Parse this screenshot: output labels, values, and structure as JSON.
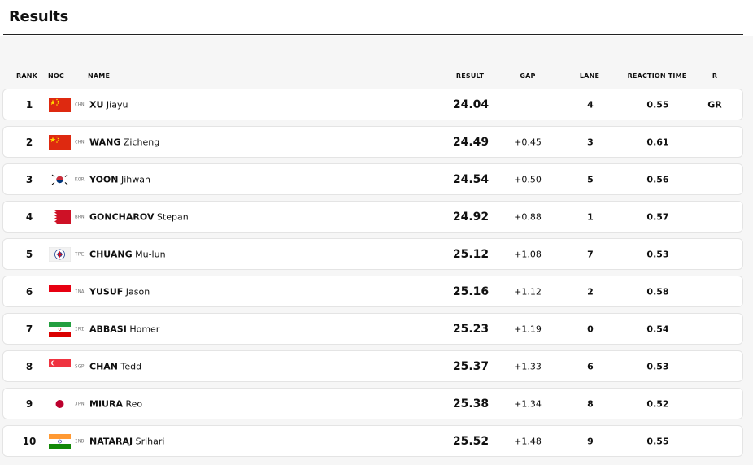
{
  "title": "Results",
  "columns": {
    "rank": "RANK",
    "noc": "NOC",
    "name": "NAME",
    "result": "RESULT",
    "gap": "GAP",
    "lane": "LANE",
    "reaction_time": "REACTION TIME",
    "r": "R"
  },
  "rows": [
    {
      "rank": "1",
      "noc": "CHN",
      "flag": "chn-flag-icon",
      "surname": "XU",
      "given": "Jiayu",
      "result": "24.04",
      "gap": "",
      "lane": "4",
      "reaction_time": "0.55",
      "record": "GR"
    },
    {
      "rank": "2",
      "noc": "CHN",
      "flag": "chn-flag-icon",
      "surname": "WANG",
      "given": "Zicheng",
      "result": "24.49",
      "gap": "+0.45",
      "lane": "3",
      "reaction_time": "0.61",
      "record": ""
    },
    {
      "rank": "3",
      "noc": "KOR",
      "flag": "kor-flag-icon",
      "surname": "YOON",
      "given": "Jihwan",
      "result": "24.54",
      "gap": "+0.50",
      "lane": "5",
      "reaction_time": "0.56",
      "record": ""
    },
    {
      "rank": "4",
      "noc": "BRN",
      "flag": "brn-flag-icon",
      "surname": "GONCHAROV",
      "given": "Stepan",
      "result": "24.92",
      "gap": "+0.88",
      "lane": "1",
      "reaction_time": "0.57",
      "record": ""
    },
    {
      "rank": "5",
      "noc": "TPE",
      "flag": "tpe-flag-icon",
      "surname": "CHUANG",
      "given": "Mu-lun",
      "result": "25.12",
      "gap": "+1.08",
      "lane": "7",
      "reaction_time": "0.53",
      "record": ""
    },
    {
      "rank": "6",
      "noc": "INA",
      "flag": "ina-flag-icon",
      "surname": "YUSUF",
      "given": "Jason",
      "result": "25.16",
      "gap": "+1.12",
      "lane": "2",
      "reaction_time": "0.58",
      "record": ""
    },
    {
      "rank": "7",
      "noc": "IRI",
      "flag": "iri-flag-icon",
      "surname": "ABBASI",
      "given": "Homer",
      "result": "25.23",
      "gap": "+1.19",
      "lane": "0",
      "reaction_time": "0.54",
      "record": ""
    },
    {
      "rank": "8",
      "noc": "SGP",
      "flag": "sgp-flag-icon",
      "surname": "CHAN",
      "given": "Tedd",
      "result": "25.37",
      "gap": "+1.33",
      "lane": "6",
      "reaction_time": "0.53",
      "record": ""
    },
    {
      "rank": "9",
      "noc": "JPN",
      "flag": "jpn-flag-icon",
      "surname": "MIURA",
      "given": "Reo",
      "result": "25.38",
      "gap": "+1.34",
      "lane": "8",
      "reaction_time": "0.52",
      "record": ""
    },
    {
      "rank": "10",
      "noc": "IND",
      "flag": "ind-flag-icon",
      "surname": "NATARAJ",
      "given": "Srihari",
      "result": "25.52",
      "gap": "+1.48",
      "lane": "9",
      "reaction_time": "0.55",
      "record": ""
    }
  ]
}
